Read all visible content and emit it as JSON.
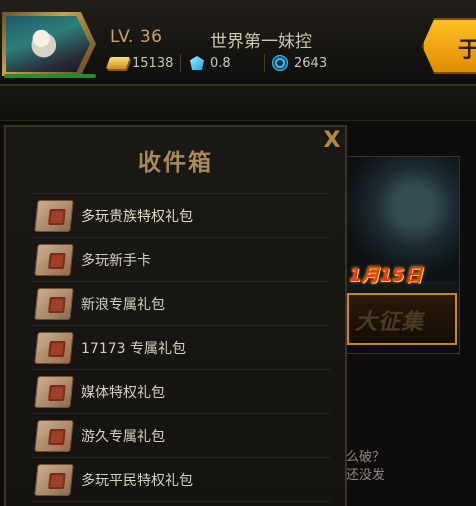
{
  "player": {
    "level": "LV. 36",
    "name": "世界第一妹控",
    "gold": "15138",
    "diamond": "0.8",
    "crystal": "2643",
    "action_label": "于"
  },
  "inbox": {
    "title": "收件箱",
    "close_label": "X",
    "items": [
      {
        "label": "多玩贵族特权礼包"
      },
      {
        "label": "多玩新手卡"
      },
      {
        "label": "新浪专属礼包"
      },
      {
        "label": "17173 专属礼包"
      },
      {
        "label": "媒体特权礼包"
      },
      {
        "label": "游久专属礼包"
      },
      {
        "label": "多玩平民特权礼包"
      }
    ]
  },
  "background": {
    "news_date": "1月15日",
    "banner_text": "大征集",
    "text_line1": "么破？",
    "text_line2": "还没发"
  },
  "colors": {
    "accent_gold": "#c8a45a",
    "title_gold": "#a8895a",
    "action_orange": "#ffc226"
  }
}
